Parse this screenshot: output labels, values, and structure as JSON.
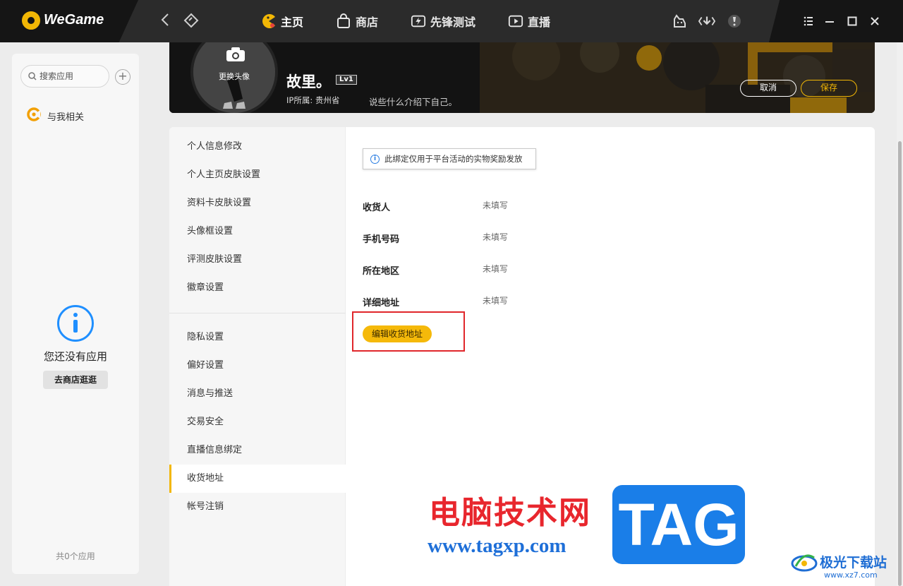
{
  "app": {
    "name": "WeGame"
  },
  "topbar": {
    "tabs": [
      {
        "label": "主页",
        "icon": "pacman-icon",
        "active": true
      },
      {
        "label": "商店",
        "icon": "shopping-bag-icon",
        "active": false
      },
      {
        "label": "先锋测试",
        "icon": "lightning-ticket-icon",
        "active": false
      },
      {
        "label": "直播",
        "icon": "play-icon",
        "active": false
      }
    ]
  },
  "sidebar": {
    "search_placeholder": "搜索应用",
    "related_label": "与我相关",
    "empty_text": "您还没有应用",
    "goto_store_label": "去商店逛逛",
    "app_count": "共0个应用"
  },
  "profile": {
    "avatar_label": "更换头像",
    "name": "故里。",
    "level": "Lv1",
    "ip_location": "IP所属: 贵州省",
    "bio_placeholder": "说些什么介绍下自己。",
    "cancel_label": "取消",
    "save_label": "保存"
  },
  "settings_menu": {
    "group1": [
      "个人信息修改",
      "个人主页皮肤设置",
      "资料卡皮肤设置",
      "头像框设置",
      "评测皮肤设置",
      "徽章设置"
    ],
    "group2": [
      "隐私设置",
      "偏好设置",
      "消息与推送",
      "交易安全",
      "直播信息绑定",
      "收货地址",
      "帐号注销"
    ],
    "active": "收货地址"
  },
  "address": {
    "notice": "此绑定仅用于平台活动的实物奖励发放",
    "fields": [
      {
        "label": "收货人",
        "value": "未填写"
      },
      {
        "label": "手机号码",
        "value": "未填写"
      },
      {
        "label": "所在地区",
        "value": "未填写"
      },
      {
        "label": "详细地址",
        "value": "未填写"
      }
    ],
    "edit_button": "编辑收货地址"
  },
  "watermarks": {
    "site_name": "电脑技术网",
    "site_url": "www.tagxp.com",
    "tag": "TAG",
    "xz7_name": "极光下载站",
    "xz7_url": "www.xz7.com"
  },
  "colors": {
    "accent": "#f2b705",
    "topbar": "#2b2b2b",
    "highlight": "#e0262b",
    "link_blue": "#1f8fff"
  }
}
